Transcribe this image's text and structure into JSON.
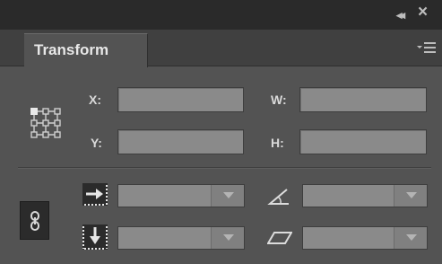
{
  "controls": {
    "collapse_glyph": "◂◂",
    "close_glyph": "×"
  },
  "tab": {
    "label": "Transform"
  },
  "icons": {
    "collapse": "double-chevron-left-icon",
    "close": "close-icon",
    "menu": "panel-menu-icon",
    "reference_point": "reference-point-grid-icon",
    "link": "link-chain-icon",
    "scale_x": "horizontal-scale-icon",
    "scale_y": "vertical-scale-icon",
    "rotate": "rotate-angle-icon",
    "shear": "shear-parallelogram-icon"
  },
  "fields": {
    "x_label": "X:",
    "y_label": "Y:",
    "w_label": "W:",
    "h_label": "H:",
    "x_value": "",
    "y_value": "",
    "w_value": "",
    "h_value": ""
  },
  "dropdowns": {
    "scale_x_value": "",
    "scale_y_value": "",
    "rotate_value": "",
    "shear_value": ""
  },
  "colors": {
    "panel_bg": "#535353",
    "topbar_bg": "#2a2a2a",
    "tabstrip_bg": "#404040",
    "field_bg": "#8a8a8a",
    "label_text": "#d9d9d9"
  }
}
